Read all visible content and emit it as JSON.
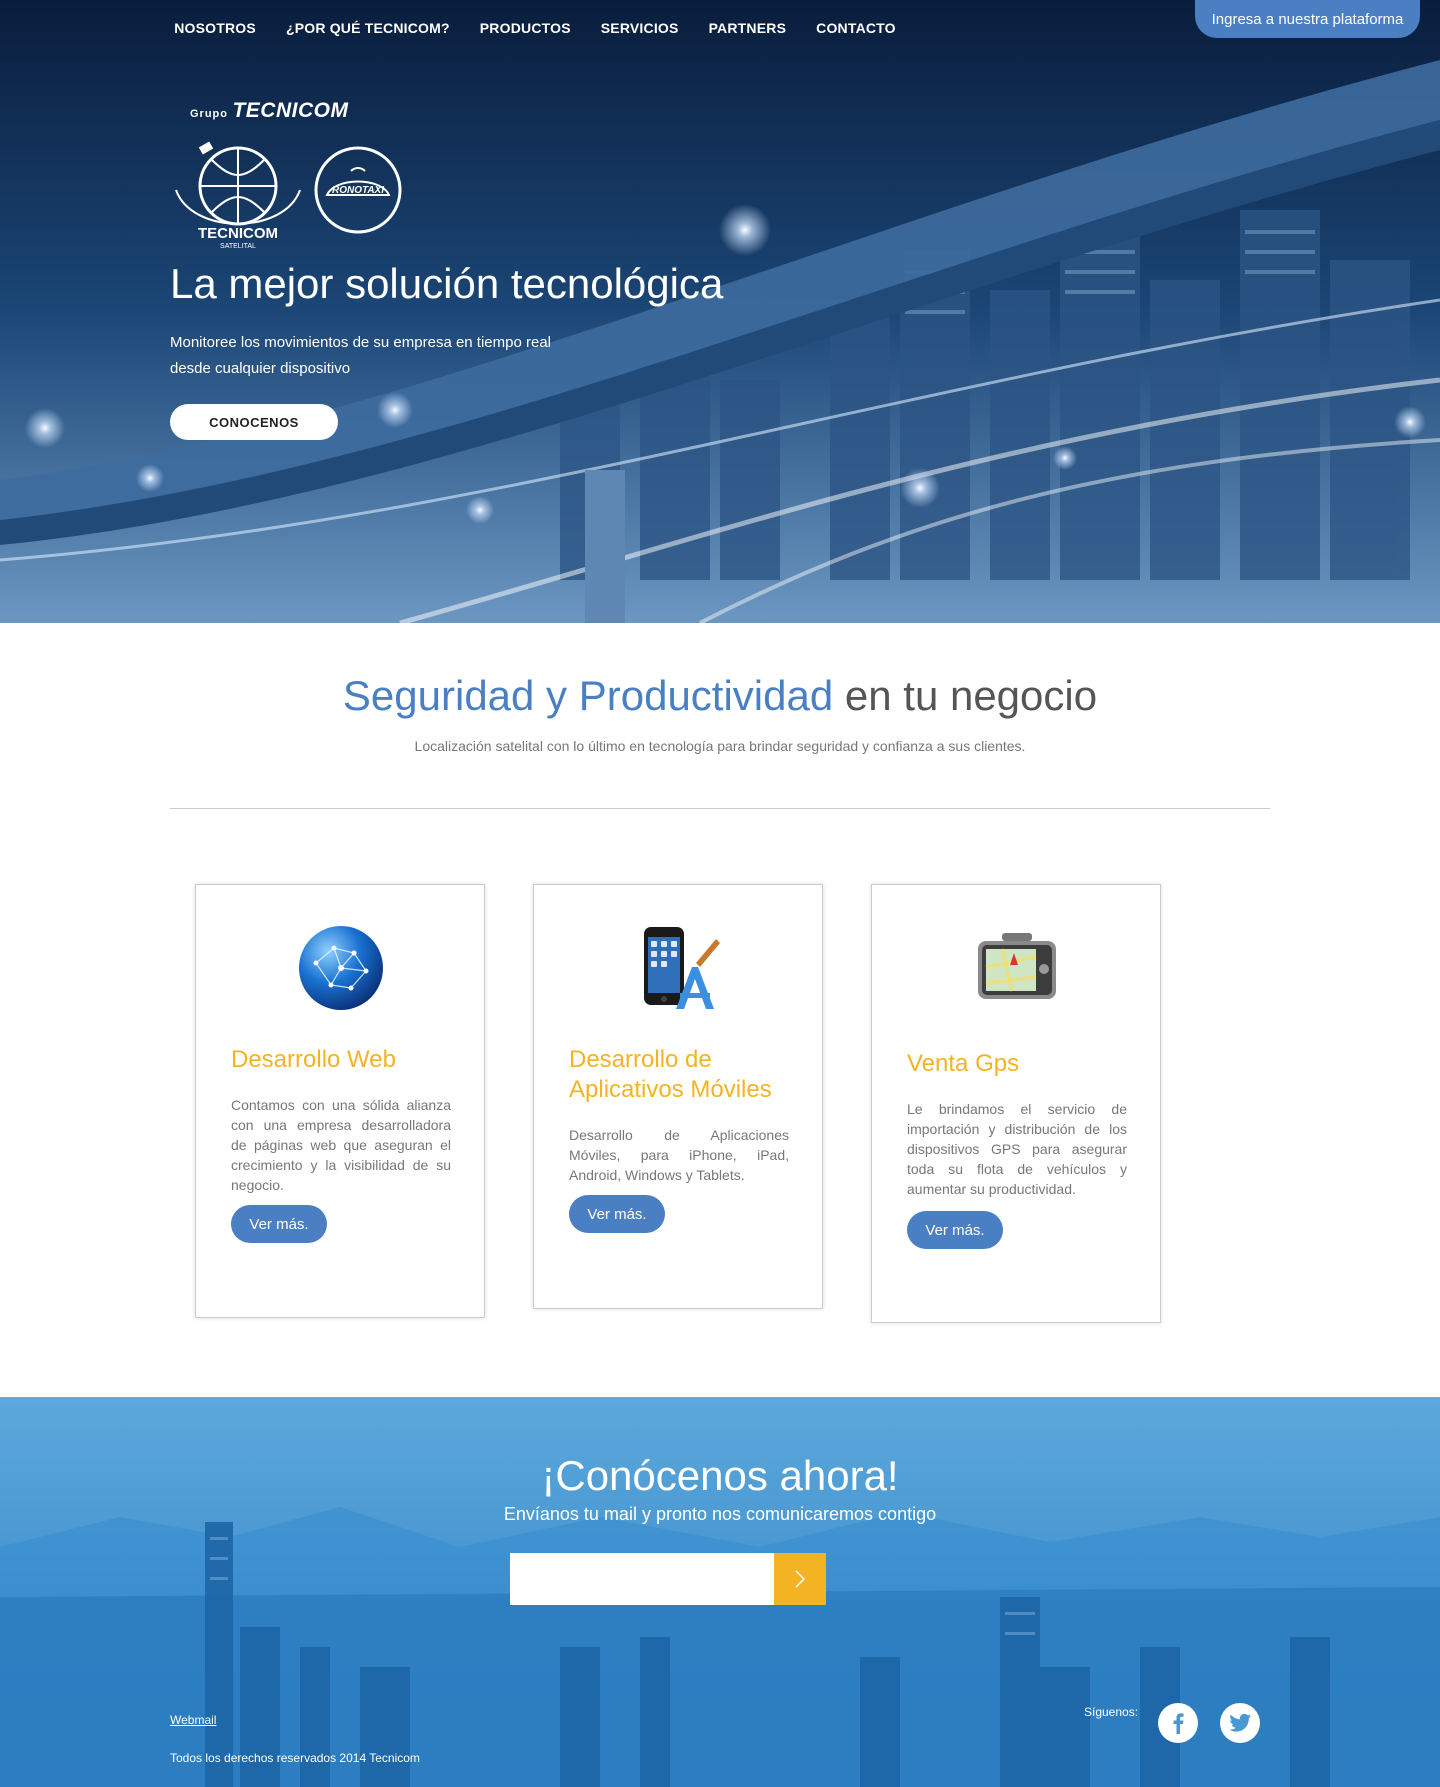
{
  "nav": {
    "items": [
      "NOSOTROS",
      "¿POR QUÉ TECNICOM?",
      "PRODUCTOS",
      "SERVICIOS",
      "PARTNERS",
      "CONTACTO"
    ],
    "platform_label": "Ingresa a nuestra plataforma"
  },
  "brand": {
    "grupo": "Grupo",
    "name": "TECNICOM",
    "logo1_text": "TECNICOM",
    "logo1_sub": "SATELITAL",
    "logo2_text": "RONOTAXI"
  },
  "hero": {
    "title": "La mejor solución tecnológica",
    "subtitle_line1": "Monitoree los movimientos de su empresa en tiempo real",
    "subtitle_line2": "desde cualquier dispositivo",
    "cta_label": "CONOCENOS"
  },
  "section": {
    "title_blue": "Seguridad y Productividad",
    "title_rest": " en tu negocio",
    "subtitle": "Localización satelital con lo último en tecnología para brindar seguridad y confianza a sus clientes."
  },
  "cards": [
    {
      "icon": "globe-network-icon",
      "title": "Desarrollo Web",
      "text": "Contamos con una sólida alianza con una empresa desarrolladora de páginas web que aseguran el crecimiento y la visibilidad de su negocio.",
      "button": "Ver más."
    },
    {
      "icon": "mobile-app-icon",
      "title": "Desarrollo de Aplicativos Móviles",
      "text": "Desarrollo de Aplicaciones Móviles, para iPhone, iPad, Android, Windows y Tablets.",
      "button": "Ver más."
    },
    {
      "icon": "gps-device-icon",
      "title": "Venta Gps",
      "text": "Le brindamos el servicio de importación y distribución de los dispositivos GPS para asegurar toda su flota de vehículos y aumentar su productividad.",
      "button": "Ver más."
    }
  ],
  "cta": {
    "title": "¡Conócenos ahora!",
    "subtitle": "Envíanos tu mail y pronto nos comunicaremos contigo",
    "email_value": ""
  },
  "footer": {
    "webmail": "Webmail",
    "rights": "Todos los derechos reservados 2014 Tecnicom",
    "follow": "Síguenos:",
    "social": [
      "facebook-icon",
      "twitter-icon"
    ]
  },
  "colors": {
    "accent_blue": "#4a7fc4",
    "accent_yellow": "#f4b323"
  }
}
